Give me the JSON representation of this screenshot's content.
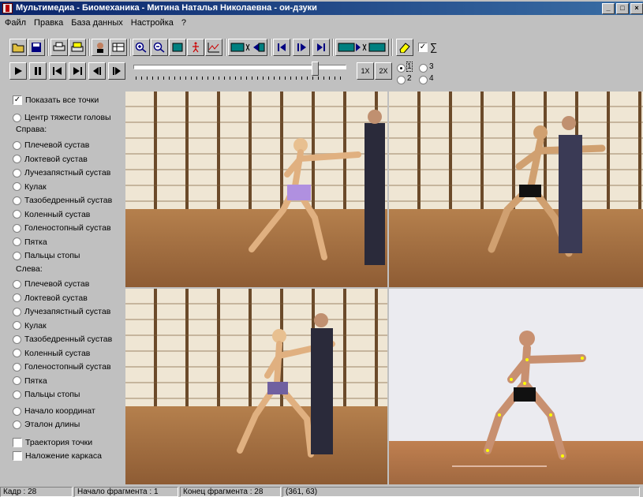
{
  "window": {
    "title": "Мультимедиа - Биомеханика  -  Митина Наталья Николаевна - ои-дзуки",
    "min": "_",
    "max": "□",
    "close": "×"
  },
  "menu": [
    "Файл",
    "Правка",
    "База данных",
    "Настройка",
    "?"
  ],
  "toolbar_icons": [
    "open-folder-icon",
    "save-icon",
    "print-icon",
    "printer-setup-icon",
    "person-icon",
    "table-icon",
    "zoom-in-icon",
    "zoom-out-icon",
    "frame-icon",
    "skeleton-icon",
    "graph-icon",
    "cut-left-icon",
    "goto-start-icon",
    "step-forward-icon",
    "goto-end-icon",
    "cut-right-icon",
    "eraser-icon"
  ],
  "sum_checkbox": {
    "checked": true,
    "label": "∑"
  },
  "playback": {
    "speed_1x": "1X",
    "speed_2x": "2X",
    "slider_position_fraction": 0.85
  },
  "view_radios": [
    {
      "label": "1",
      "checked": true
    },
    {
      "label": "3",
      "checked": false
    },
    {
      "label": "2",
      "checked": false
    },
    {
      "label": "4",
      "checked": false
    }
  ],
  "left_panel": {
    "show_all_points": {
      "label": "Показать все точки",
      "checked": true
    },
    "head_center": "Центр тяжести головы",
    "right_heading": "Справа:",
    "right_items": [
      "Плечевой сустав",
      "Локтевой сустав",
      "Лучезапястный сустав",
      "Кулак",
      "Тазобедренный сустав",
      "Коленный сустав",
      "Голеностопный сустав",
      "Пятка",
      "Пальцы стопы"
    ],
    "left_heading": "Слева:",
    "left_items": [
      "Плечевой сустав",
      "Локтевой сустав",
      "Лучезапястный сустав",
      "Кулак",
      "Тазобедренный сустав",
      "Коленный сустав",
      "Голеностопный сустав",
      "Пятка",
      "Пальцы стопы"
    ],
    "origin": "Начало координат",
    "length_ref": "Эталон длины",
    "trajectory": {
      "label": "Траектория точки",
      "checked": false
    },
    "overlay": {
      "label": "Наложение каркаса",
      "checked": false
    }
  },
  "status": {
    "frame": "Кадр : 28",
    "fragment_start": "Начало фрагмента : 1",
    "fragment_end": "Конец фрагмента : 28",
    "coords": "(361, 63)"
  },
  "colors": {
    "title_start": "#0a246a",
    "title_end": "#3a6ea5",
    "face": "#c0c0c0"
  }
}
